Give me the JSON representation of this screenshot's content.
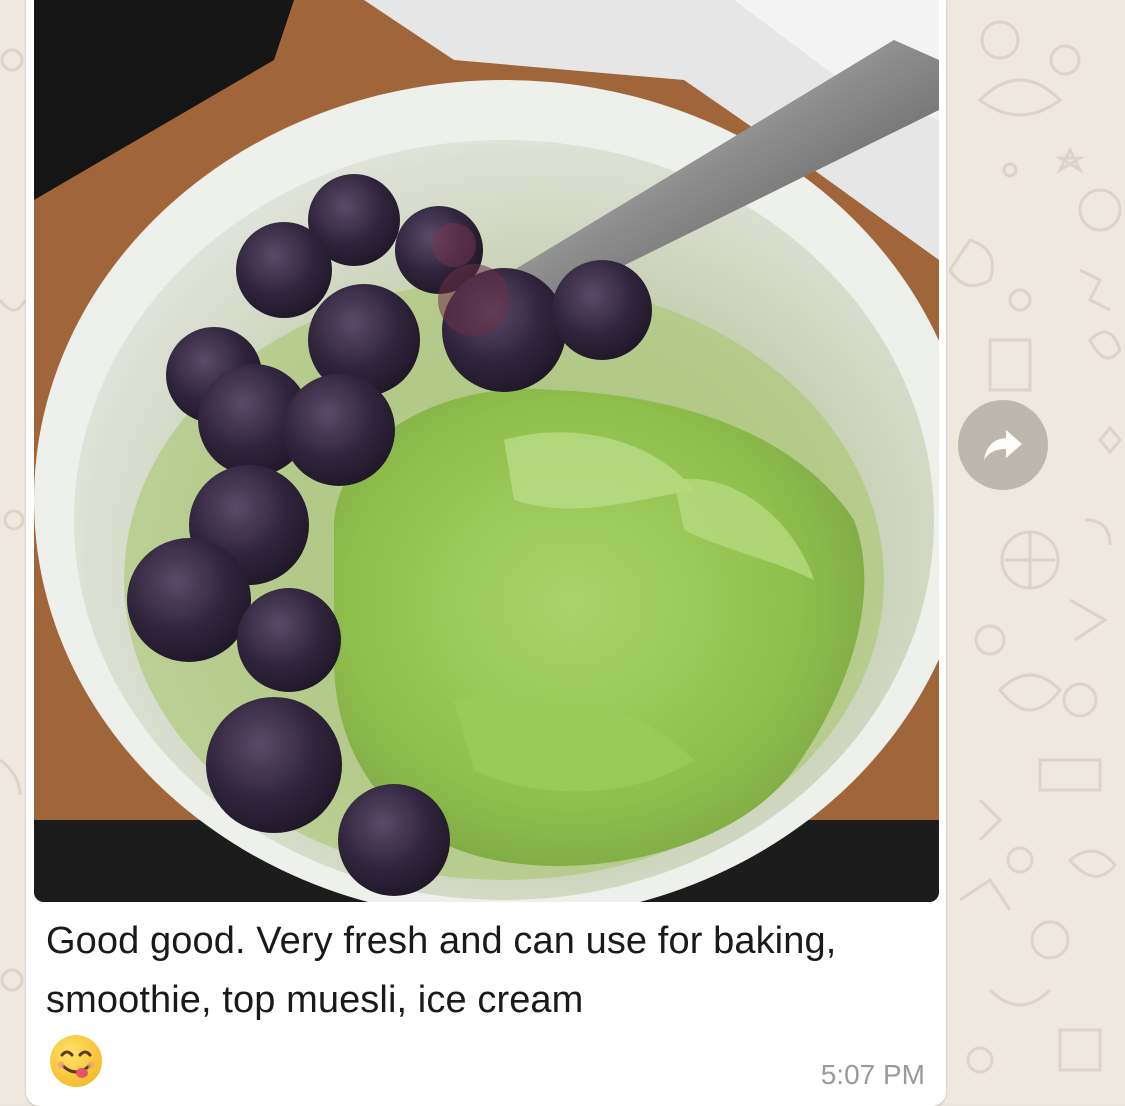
{
  "message": {
    "caption": "Good good. Very fresh and can use for baking, smoothie, top muesli, ice cream",
    "emoji": "yum-face-emoji",
    "timestamp": "5:07 PM",
    "image_subject": "matcha-icecream-with-blueberries-photo"
  },
  "actions": {
    "forward_icon": "forward-arrow-icon"
  },
  "colors": {
    "bubble": "#ffffff",
    "wallpaper": "#efe8df",
    "timestamp": "#9a9a9a",
    "forward_button": "#b8b2ab"
  }
}
